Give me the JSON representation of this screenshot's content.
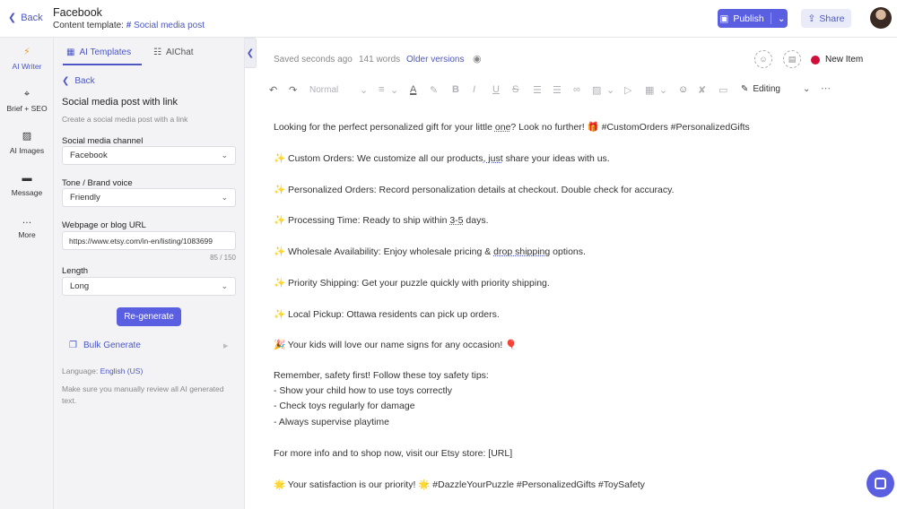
{
  "header": {
    "back_label": "Back",
    "title": "Facebook",
    "template_prefix": "Content template:",
    "template_name": "Social media post",
    "publish_label": "Publish",
    "share_label": "Share"
  },
  "rail": {
    "items": [
      {
        "label": "AI Writer",
        "icon": "lightning-icon"
      },
      {
        "label": "Brief + SEO",
        "icon": "target-icon"
      },
      {
        "label": "AI Images",
        "icon": "image-icon"
      },
      {
        "label": "Message",
        "icon": "message-icon"
      },
      {
        "label": "More",
        "icon": "more-icon"
      }
    ]
  },
  "panel": {
    "tabs": [
      {
        "label": "AI Templates",
        "active": true
      },
      {
        "label": "AIChat",
        "active": false
      }
    ],
    "back_label": "Back",
    "title": "Social media post with link",
    "description": "Create a social media post with a link",
    "fields": {
      "channel_label": "Social media channel",
      "channel_value": "Facebook",
      "tone_label": "Tone / Brand voice",
      "tone_value": "Friendly",
      "url_label": "Webpage or blog URL",
      "url_value": "https://www.etsy.com/in-en/listing/1083699",
      "url_counter": "85 / 150",
      "length_label": "Length",
      "length_value": "Long"
    },
    "regenerate_label": "Re-generate",
    "bulk_label": "Bulk Generate",
    "language_prefix": "Language:",
    "language_value": "English (US)",
    "review_note": "Make sure you manually review all AI generated text."
  },
  "editor": {
    "saved": "Saved seconds ago",
    "words": "141 words",
    "versions": "Older versions",
    "new_item": "New Item",
    "style_value": "Normal",
    "mode": "Editing",
    "content": {
      "l1a": "Looking for the perfect personalized gift for your little ",
      "l1b": "one",
      "l1c": "? Look no further! 🎁 #CustomOrders #PersonalizedGifts",
      "l2a": "✨ Custom Orders: We customize all our products",
      "l2b": ", just",
      "l2c": " share your ideas with us.",
      "l3": "✨ Personalized Orders: Record personalization details at checkout. Double check for accuracy.",
      "l4a": "✨ Processing Time: Ready to ship within ",
      "l4b": "3-5",
      "l4c": " days.",
      "l5a": "✨ Wholesale Availability: Enjoy wholesale pricing & ",
      "l5b": "drop shipping",
      "l5c": " options.",
      "l6": "✨ Priority Shipping: Get your puzzle quickly with priority shipping.",
      "l7": "✨ Local Pickup: Ottawa residents can pick up orders.",
      "l8": "🎉 Your kids will love our name signs for any occasion! 🎈",
      "l9": "Remember, safety first! Follow these toy safety tips:",
      "l10": "- Show your child how to use toys correctly",
      "l11": "- Check toys regularly for damage",
      "l12": "- Always supervise playtime",
      "l13": "For more info and to shop now, visit our Etsy store: [URL]",
      "l14": "🌟 Your satisfaction is our priority! 🌟 #DazzleYourPuzzle #PersonalizedGifts #ToySafety"
    }
  },
  "colors": {
    "accent": "#5a5ee0",
    "link": "#4c57c4",
    "status_dot": "#d0103a"
  }
}
